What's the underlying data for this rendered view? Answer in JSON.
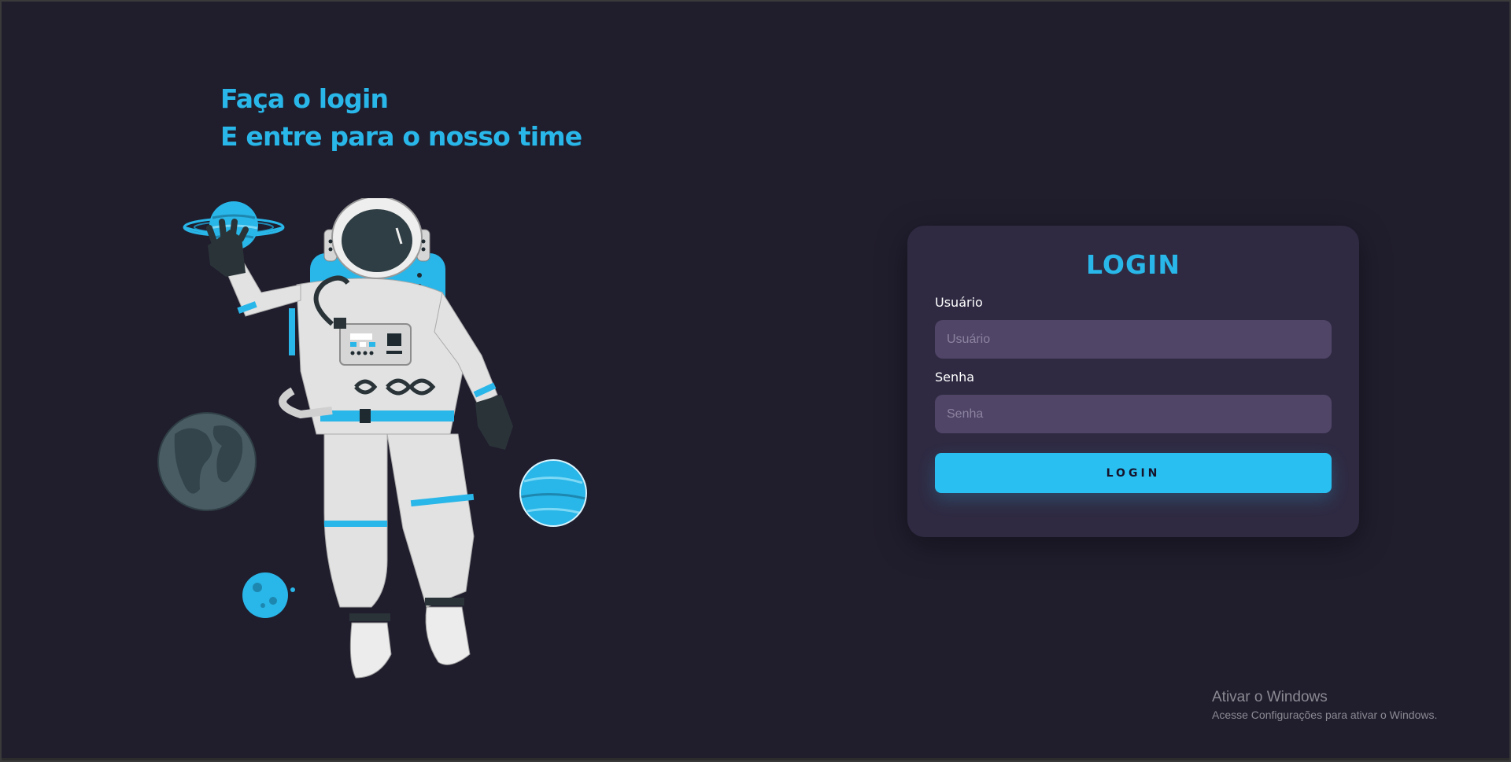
{
  "headline": {
    "line1": "Faça o login",
    "line2": "E entre para o nosso time"
  },
  "illustration": {
    "name": "astronaut-with-planets"
  },
  "login_form": {
    "title": "LOGIN",
    "username_label": "Usuário",
    "username_placeholder": "Usuário",
    "username_value": "",
    "password_label": "Senha",
    "password_placeholder": "Senha",
    "password_value": "",
    "submit_label": "LOGIN"
  },
  "watermark": {
    "title": "Ativar o Windows",
    "subtitle": "Acesse Configurações para ativar o Windows."
  },
  "colors": {
    "background": "#201d2d",
    "card": "#2f2a42",
    "input": "#504567",
    "accent": "#29bff0"
  }
}
